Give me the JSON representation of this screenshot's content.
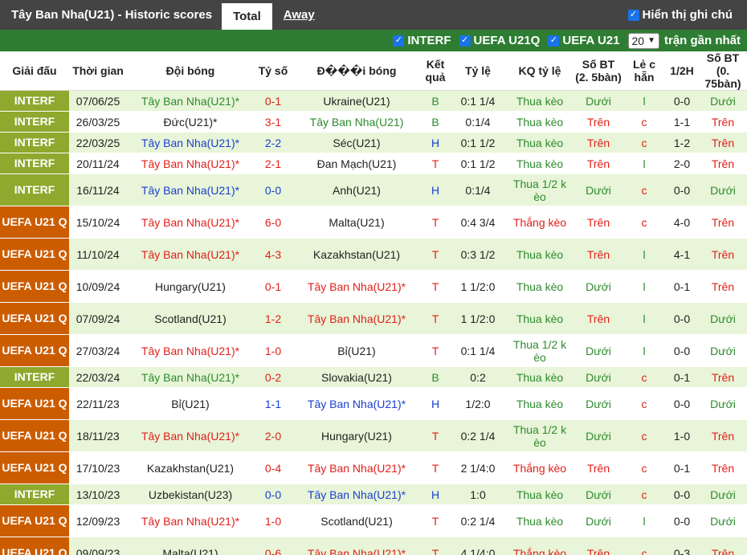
{
  "header": {
    "title": "Tây Ban Nha(U21) - Historic scores",
    "tabs": [
      {
        "label": "Total"
      },
      {
        "label": "Away"
      }
    ],
    "show_label": "Hiển thị ghi chú"
  },
  "filters": {
    "items": [
      {
        "label": "INTERF"
      },
      {
        "label": "UEFA U21Q"
      },
      {
        "label": "UEFA U21"
      }
    ],
    "count": "20",
    "recent_label": "trận gần nhất"
  },
  "columns": [
    "Giải đấu",
    "Thời gian",
    "Đội bóng",
    "Tỷ số",
    "Đ���i bóng",
    "Kết quả",
    "Tỷ lệ",
    "KQ tỷ lệ",
    "Số BT (2. 5bàn)",
    "Lẻ c hẵn",
    "1/2H",
    "Số BT (0. 75bàn)"
  ],
  "rows": [
    {
      "league": "INTERF",
      "date": "07/06/25",
      "home": "Tây Ban Nha(U21)*",
      "score": "0-1",
      "away": "Ukraine(U21)",
      "result": "B",
      "odds": "0:1 1/4",
      "odds_result": "Thua kèo",
      "bt25": "Dưới",
      "oe": "l",
      "half": "0-0",
      "bt075": "Dưới"
    },
    {
      "league": "INTERF",
      "date": "26/03/25",
      "home": "Đức(U21)*",
      "score": "3-1",
      "away": "Tây Ban Nha(U21)",
      "result": "B",
      "odds": "0:1/4",
      "odds_result": "Thua kèo",
      "bt25": "Trên",
      "oe": "c",
      "half": "1-1",
      "bt075": "Trên"
    },
    {
      "league": "INTERF",
      "date": "22/03/25",
      "home": "Tây Ban Nha(U21)*",
      "score": "2-2",
      "away": "Séc(U21)",
      "result": "H",
      "odds": "0:1 1/2",
      "odds_result": "Thua kèo",
      "bt25": "Trên",
      "oe": "c",
      "half": "1-2",
      "bt075": "Trên"
    },
    {
      "league": "INTERF",
      "date": "20/11/24",
      "home": "Tây Ban Nha(U21)*",
      "score": "2-1",
      "away": "Đan Mạch(U21)",
      "result": "T",
      "odds": "0:1 1/2",
      "odds_result": "Thua kèo",
      "bt25": "Trên",
      "oe": "l",
      "half": "2-0",
      "bt075": "Trên"
    },
    {
      "league": "INTERF",
      "date": "16/11/24",
      "home": "Tây Ban Nha(U21)*",
      "score": "0-0",
      "away": "Anh(U21)",
      "result": "H",
      "odds": "0:1/4",
      "odds_result": "Thua 1/2 k èo",
      "bt25": "Dưới",
      "oe": "c",
      "half": "0-0",
      "bt075": "Dưới"
    },
    {
      "league": "UEFA U21 Q",
      "date": "15/10/24",
      "home": "Tây Ban Nha(U21)*",
      "score": "6-0",
      "away": "Malta(U21)",
      "result": "T",
      "odds": "0:4 3/4",
      "odds_result": "Thắng kèo",
      "bt25": "Trên",
      "oe": "c",
      "half": "4-0",
      "bt075": "Trên"
    },
    {
      "league": "UEFA U21 Q",
      "date": "11/10/24",
      "home": "Tây Ban Nha(U21)*",
      "score": "4-3",
      "away": "Kazakhstan(U21)",
      "result": "T",
      "odds": "0:3 1/2",
      "odds_result": "Thua kèo",
      "bt25": "Trên",
      "oe": "l",
      "half": "4-1",
      "bt075": "Trên"
    },
    {
      "league": "UEFA U21 Q",
      "date": "10/09/24",
      "home": "Hungary(U21)",
      "score": "0-1",
      "away": "Tây Ban Nha(U21)*",
      "result": "T",
      "odds": "1 1/2:0",
      "odds_result": "Thua kèo",
      "bt25": "Dưới",
      "oe": "l",
      "half": "0-1",
      "bt075": "Trên"
    },
    {
      "league": "UEFA U21 Q",
      "date": "07/09/24",
      "home": "Scotland(U21)",
      "score": "1-2",
      "away": "Tây Ban Nha(U21)*",
      "result": "T",
      "odds": "1 1/2:0",
      "odds_result": "Thua kèo",
      "bt25": "Trên",
      "oe": "l",
      "half": "0-0",
      "bt075": "Dưới"
    },
    {
      "league": "UEFA U21 Q",
      "date": "27/03/24",
      "home": "Tây Ban Nha(U21)*",
      "score": "1-0",
      "away": "Bỉ(U21)",
      "result": "T",
      "odds": "0:1 1/4",
      "odds_result": "Thua 1/2 k èo",
      "bt25": "Dưới",
      "oe": "l",
      "half": "0-0",
      "bt075": "Dưới"
    },
    {
      "league": "INTERF",
      "date": "22/03/24",
      "home": "Tây Ban Nha(U21)*",
      "score": "0-2",
      "away": "Slovakia(U21)",
      "result": "B",
      "odds": "0:2",
      "odds_result": "Thua kèo",
      "bt25": "Dưới",
      "oe": "c",
      "half": "0-1",
      "bt075": "Trên"
    },
    {
      "league": "UEFA U21 Q",
      "date": "22/11/23",
      "home": "Bỉ(U21)",
      "score": "1-1",
      "away": "Tây Ban Nha(U21)*",
      "result": "H",
      "odds": "1/2:0",
      "odds_result": "Thua kèo",
      "bt25": "Dưới",
      "oe": "c",
      "half": "0-0",
      "bt075": "Dưới"
    },
    {
      "league": "UEFA U21 Q",
      "date": "18/11/23",
      "home": "Tây Ban Nha(U21)*",
      "score": "2-0",
      "away": "Hungary(U21)",
      "result": "T",
      "odds": "0:2 1/4",
      "odds_result": "Thua 1/2 k èo",
      "bt25": "Dưới",
      "oe": "c",
      "half": "1-0",
      "bt075": "Trên"
    },
    {
      "league": "UEFA U21 Q",
      "date": "17/10/23",
      "home": "Kazakhstan(U21)",
      "score": "0-4",
      "away": "Tây Ban Nha(U21)*",
      "result": "T",
      "odds": "2 1/4:0",
      "odds_result": "Thắng kèo",
      "bt25": "Trên",
      "oe": "c",
      "half": "0-1",
      "bt075": "Trên"
    },
    {
      "league": "INTERF",
      "date": "13/10/23",
      "home": "Uzbekistan(U23)",
      "score": "0-0",
      "away": "Tây Ban Nha(U21)*",
      "result": "H",
      "odds": "1:0",
      "odds_result": "Thua kèo",
      "bt25": "Dưới",
      "oe": "c",
      "half": "0-0",
      "bt075": "Dưới"
    },
    {
      "league": "UEFA U21 Q",
      "date": "12/09/23",
      "home": "Tây Ban Nha(U21)*",
      "score": "1-0",
      "away": "Scotland(U21)",
      "result": "T",
      "odds": "0:2 1/4",
      "odds_result": "Thua kèo",
      "bt25": "Dưới",
      "oe": "l",
      "half": "0-0",
      "bt075": "Dưới"
    },
    {
      "league": "UEFA U21 Q",
      "date": "09/09/23",
      "home": "Malta(U21)",
      "score": "0-6",
      "away": "Tây Ban Nha(U21)*",
      "result": "T",
      "odds": "4 1/4:0",
      "odds_result": "Thắng kèo",
      "bt25": "Trên",
      "oe": "c",
      "half": "0-3",
      "bt075": "Trên"
    }
  ]
}
